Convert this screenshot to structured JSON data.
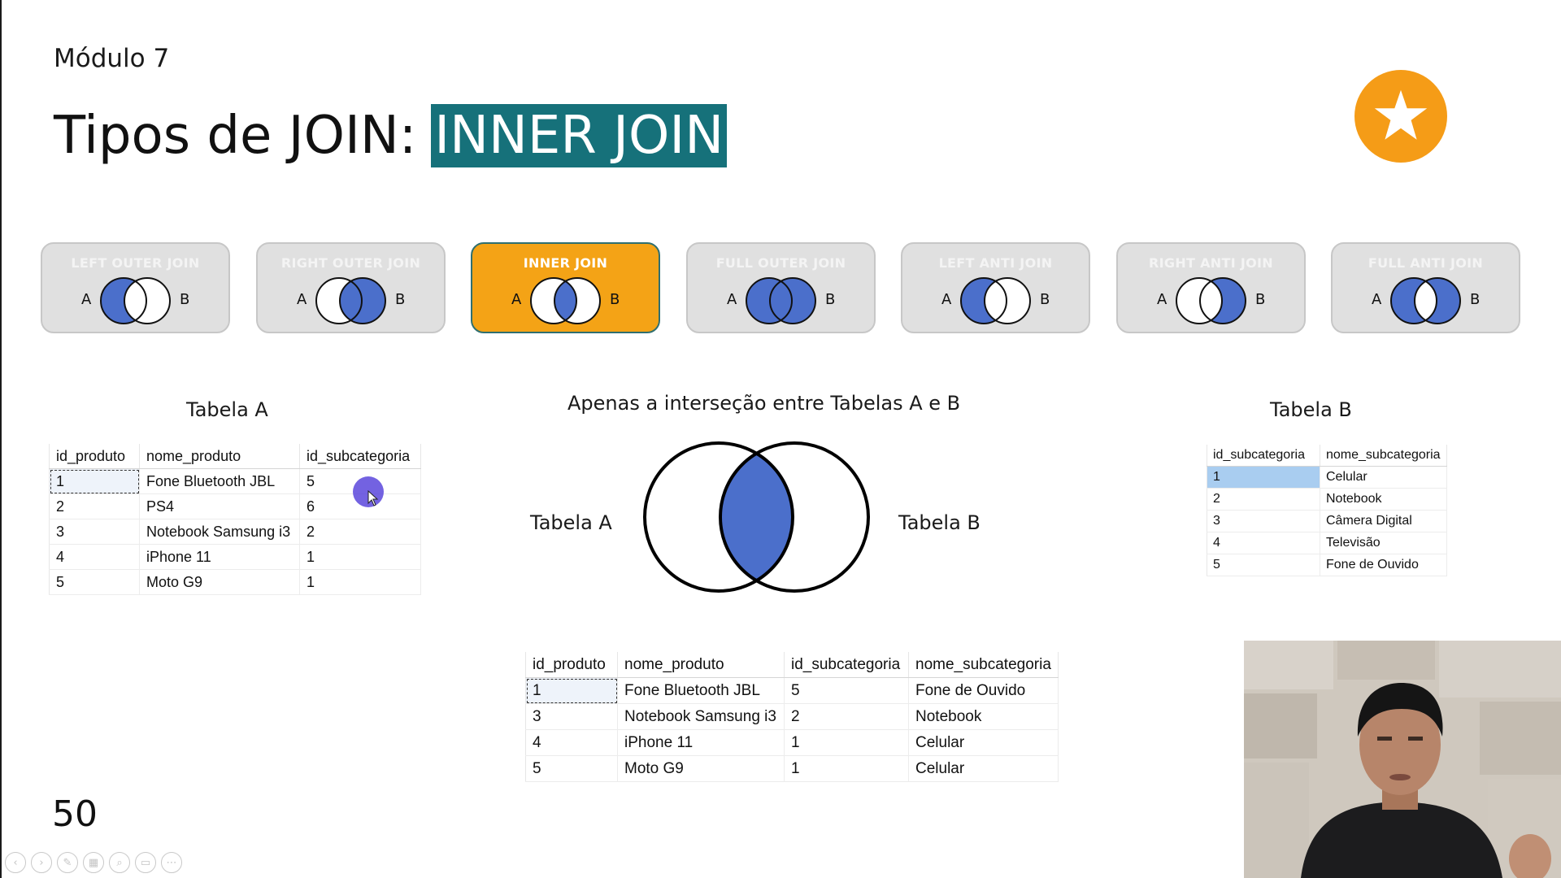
{
  "slide": {
    "module": "Módulo 7",
    "title_prefix": "Tipos de JOIN:",
    "title_highlight": "INNER JOIN",
    "slide_number": "50",
    "accent_teal": "#16717a",
    "accent_orange": "#f4a316",
    "venn_blue": "#4b6fcb",
    "badge_icon": "star-icon"
  },
  "join_types": [
    {
      "label": "LEFT OUTER JOIN",
      "a": "A",
      "b": "B",
      "active": false
    },
    {
      "label": "RIGHT OUTER JOIN",
      "a": "A",
      "b": "B",
      "active": false
    },
    {
      "label": "INNER JOIN",
      "a": "A",
      "b": "B",
      "active": true
    },
    {
      "label": "FULL OUTER JOIN",
      "a": "A",
      "b": "B",
      "active": false
    },
    {
      "label": "LEFT ANTI JOIN",
      "a": "A",
      "b": "B",
      "active": false
    },
    {
      "label": "RIGHT ANTI JOIN",
      "a": "A",
      "b": "B",
      "active": false
    },
    {
      "label": "FULL ANTI JOIN",
      "a": "A",
      "b": "B",
      "active": false
    }
  ],
  "table_a": {
    "title": "Tabela A",
    "columns": [
      "id_produto",
      "nome_produto",
      "id_subcategoria"
    ],
    "rows": [
      [
        "1",
        "Fone Bluetooth JBL",
        "5"
      ],
      [
        "2",
        "PS4",
        "6"
      ],
      [
        "3",
        "Notebook Samsung i3",
        "2"
      ],
      [
        "4",
        "iPhone 11",
        "1"
      ],
      [
        "5",
        "Moto G9",
        "1"
      ]
    ]
  },
  "table_b": {
    "title": "Tabela B",
    "columns": [
      "id_subcategoria",
      "nome_subcategoria"
    ],
    "rows": [
      [
        "1",
        "Celular"
      ],
      [
        "2",
        "Notebook"
      ],
      [
        "3",
        "Câmera Digital"
      ],
      [
        "4",
        "Televisão"
      ],
      [
        "5",
        "Fone de Ouvido"
      ]
    ]
  },
  "venn": {
    "caption": "Apenas a interseção entre Tabelas A e B",
    "label_left": "Tabela A",
    "label_right": "Tabela B"
  },
  "result_table": {
    "columns": [
      "id_produto",
      "nome_produto",
      "id_subcategoria",
      "nome_subcategoria"
    ],
    "rows": [
      [
        "1",
        "Fone Bluetooth JBL",
        "5",
        "Fone de Ouvido"
      ],
      [
        "3",
        "Notebook Samsung i3",
        "2",
        "Notebook"
      ],
      [
        "4",
        "iPhone 11",
        "1",
        "Celular"
      ],
      [
        "5",
        "Moto G9",
        "1",
        "Celular"
      ]
    ]
  },
  "toolbar": {
    "buttons": [
      {
        "name": "previous-slide-button",
        "icon": "‹"
      },
      {
        "name": "next-slide-button",
        "icon": "›"
      },
      {
        "name": "pen-tool-button",
        "icon": "✎"
      },
      {
        "name": "see-all-slides-button",
        "icon": "▦"
      },
      {
        "name": "zoom-button",
        "icon": "⌕"
      },
      {
        "name": "subtitles-button",
        "icon": "▭"
      },
      {
        "name": "more-options-button",
        "icon": "⋯"
      }
    ]
  }
}
